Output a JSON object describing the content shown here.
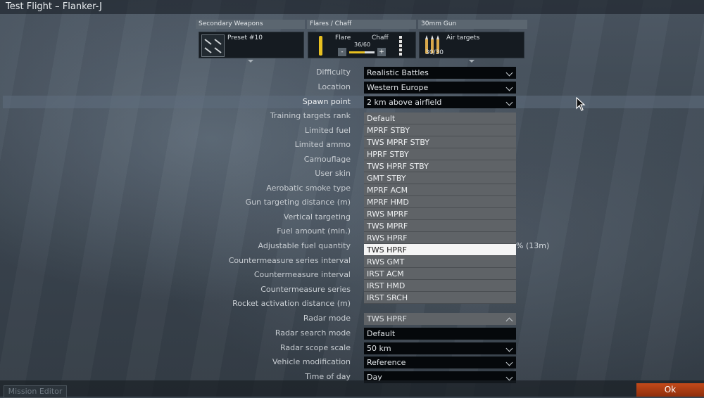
{
  "window": {
    "title": "Test Flight – Flanker-J"
  },
  "weapons": {
    "secondary": {
      "header": "Secondary Weapons",
      "preset": "Preset #10"
    },
    "countermeasures": {
      "header": "Flares / Chaff",
      "flare_label": "Flare",
      "chaff_label": "Chaff",
      "ratio": "36/60",
      "ratio_fraction": 0.6,
      "minus": "-",
      "plus": "+"
    },
    "gun": {
      "header": "30mm Gun",
      "ammo_type": "Air targets",
      "count": "30/30"
    }
  },
  "settings": [
    {
      "label": "Difficulty",
      "value": "Realistic Battles"
    },
    {
      "label": "Location",
      "value": "Western Europe"
    },
    {
      "label": "Spawn point",
      "value": "2 km above airfield"
    },
    {
      "label": "Training targets rank",
      "value": ""
    },
    {
      "label": "Limited fuel",
      "value": ""
    },
    {
      "label": "Limited ammo",
      "value": ""
    },
    {
      "label": "Camouflage",
      "value": ""
    },
    {
      "label": "User skin",
      "value": ""
    },
    {
      "label": "Aerobatic smoke type",
      "value": ""
    },
    {
      "label": "Gun targeting distance (m)",
      "value": ""
    },
    {
      "label": "Vertical targeting",
      "value": ""
    },
    {
      "label": "Fuel amount (min.)",
      "value": ""
    },
    {
      "label": "Adjustable fuel quantity",
      "value": "% (13m)"
    },
    {
      "label": "Countermeasure series interval",
      "value": ""
    },
    {
      "label": "Countermeasure interval",
      "value": ""
    },
    {
      "label": "Countermeasure series",
      "value": ""
    },
    {
      "label": "Rocket activation distance (m)",
      "value": ""
    },
    {
      "label": "Radar mode",
      "value": "TWS HPRF"
    },
    {
      "label": "Radar search mode",
      "value": "Default"
    },
    {
      "label": "Radar scope scale",
      "value": "50 km"
    },
    {
      "label": "Vehicle modification",
      "value": "Reference"
    },
    {
      "label": "Time of day",
      "value": "Day"
    }
  ],
  "radar_mode_options": [
    "Default",
    "MPRF STBY",
    "TWS MPRF STBY",
    "HPRF STBY",
    "TWS HPRF STBY",
    "GMT STBY",
    "MPRF ACM",
    "MPRF HMD",
    "RWS MPRF",
    "TWS MPRF",
    "RWS HPRF",
    "TWS HPRF",
    "RWS GMT",
    "IRST ACM",
    "IRST HMD",
    "IRST SRCH"
  ],
  "radar_mode_selected": "TWS HPRF",
  "footer": {
    "mission_editor": "Mission Editor",
    "ok": "Ok"
  },
  "colors": {
    "accent": "#c24a1a",
    "flare_bar": "#e8c020"
  }
}
